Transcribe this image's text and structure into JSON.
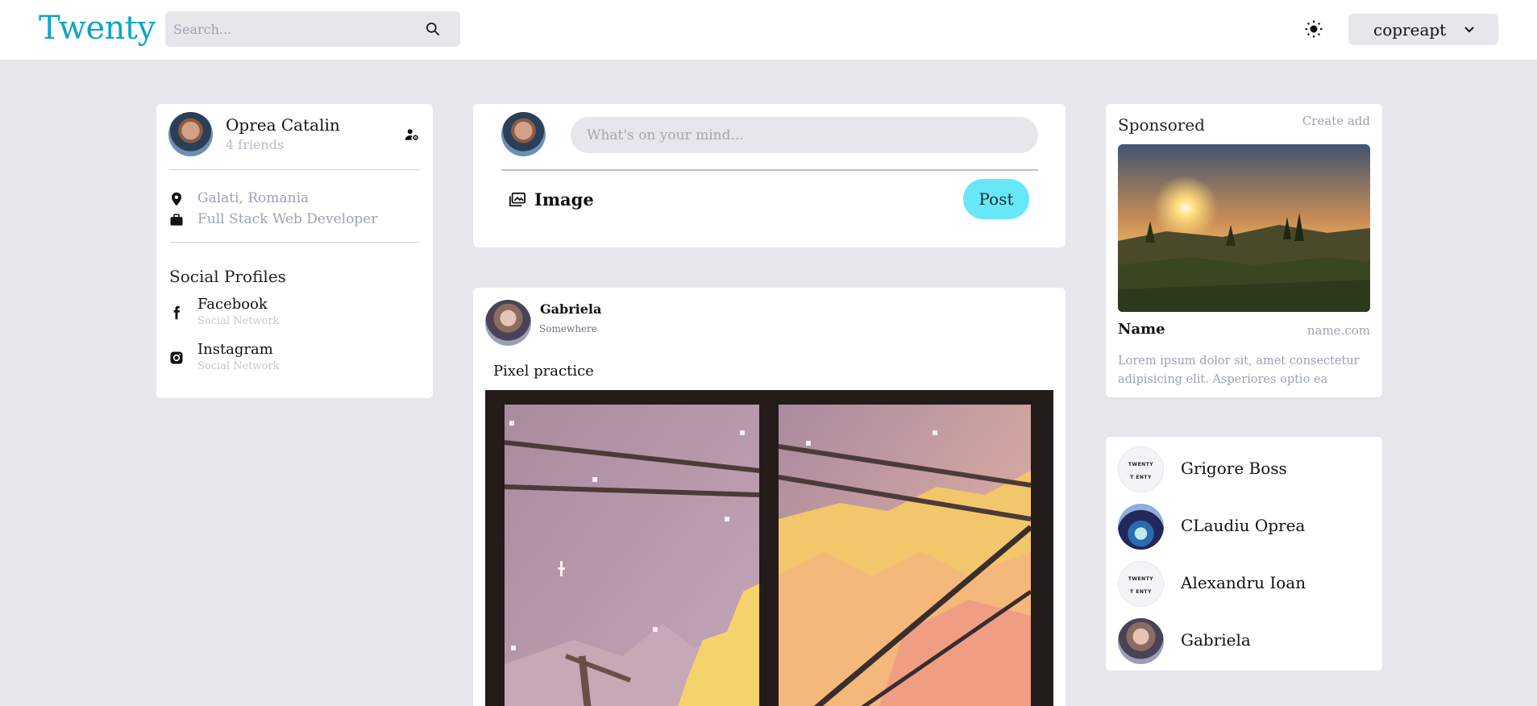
{
  "header": {
    "logo": "Twenty",
    "search_placeholder": "Search...",
    "username": "copreapt"
  },
  "profile": {
    "name": "Oprea Catalin",
    "friends": "4 friends",
    "location": "Galati, Romania",
    "occupation": "Full Stack Web Developer",
    "social_title": "Social Profiles",
    "socials": [
      {
        "name": "Facebook",
        "sub": "Social Network"
      },
      {
        "name": "Instagram",
        "sub": "Social Network"
      }
    ]
  },
  "composer": {
    "placeholder": "What's on your mind...",
    "image_label": "Image",
    "post_label": "Post"
  },
  "post": {
    "author": "Gabriela",
    "location": "Somewhere",
    "caption": "Pixel practice"
  },
  "sponsored": {
    "title": "Sponsored",
    "create": "Create add",
    "ad_name": "Name",
    "ad_url": "name.com",
    "ad_desc": "Lorem ipsum dolor sit, amet consectetur adipisicing elit. Asperiores optio ea"
  },
  "friends": [
    {
      "name": "Grigore Boss",
      "avatar": "twenty-logo"
    },
    {
      "name": "CLaudiu Oprea",
      "avatar": "photo"
    },
    {
      "name": "Alexandru Ioan",
      "avatar": "twenty-logo"
    },
    {
      "name": "Gabriela",
      "avatar": "photo"
    }
  ],
  "colors": {
    "brand": "#0ea5c6",
    "post_button": "#67e8f9",
    "page_bg": "#e5e7eb"
  }
}
